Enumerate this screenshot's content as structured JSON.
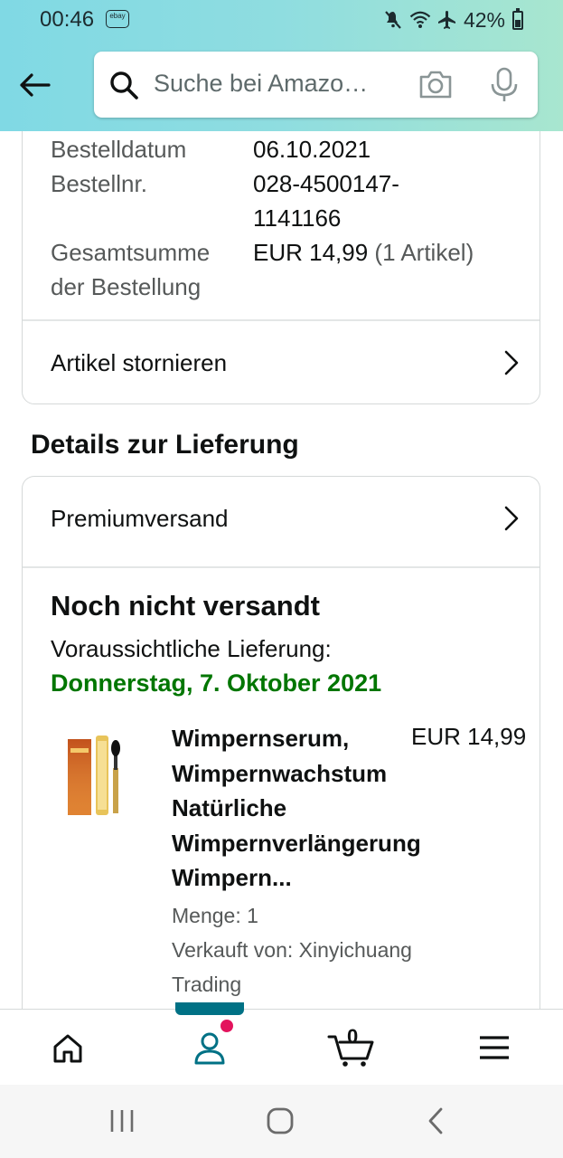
{
  "status_bar": {
    "time": "00:46",
    "notification_badge": "ebay",
    "battery_percent": "42%",
    "battery_level": 0.42,
    "icons": [
      "mute-icon",
      "wifi-icon",
      "airplane-mode-icon",
      "battery-icon"
    ]
  },
  "header": {
    "back_icon": "arrow-left-icon",
    "search": {
      "placeholder": "Suche bei Amazo…",
      "icons": [
        "search-icon",
        "camera-icon",
        "microphone-icon"
      ]
    },
    "colors": {
      "gradient_start": "#80d9e4",
      "gradient_end": "#a8e6cf"
    }
  },
  "order_summary": {
    "date_label": "Bestelldatum",
    "date_value": "06.10.2021",
    "order_no_label": "Bestellnr.",
    "order_no_value_line1": "028-4500147-",
    "order_no_value_line2": "1141166",
    "total_label_line1": "Gesamtsumme",
    "total_label_line2": "der Bestellung",
    "total_value": "EUR 14,99",
    "total_items": "(1 Artikel)",
    "cancel_label": "Artikel stornieren"
  },
  "delivery": {
    "section_title": "Details zur Lieferung",
    "shipping_method": "Premiumversand",
    "status": "Noch nicht versandt",
    "eta_label": "Voraussichtliche Lieferung:",
    "eta_date": "Donnerstag, 7. Oktober 2021",
    "eta_color": "#007600",
    "item": {
      "title_line1": "Wimpernserum,",
      "title_line2": "Wimpernwachstum",
      "title_line3": "Natürliche",
      "title_line4": "Wimpernverlängerung",
      "title_line5": "Wimpern...",
      "price": "EUR 14,99",
      "quantity": "Menge: 1",
      "seller_line1": "Verkauft von: Xinyichuang",
      "seller_line2": "Trading"
    }
  },
  "tab_bar": {
    "tabs": [
      "home-icon",
      "account-icon",
      "cart-icon",
      "menu-icon"
    ],
    "active_tab": "account-icon",
    "cart_count": "0",
    "accent": "#007185",
    "notification_color": "#e3135d"
  },
  "system_nav": {
    "buttons": [
      "recents-icon",
      "home-circle-icon",
      "back-chevron-icon"
    ]
  }
}
